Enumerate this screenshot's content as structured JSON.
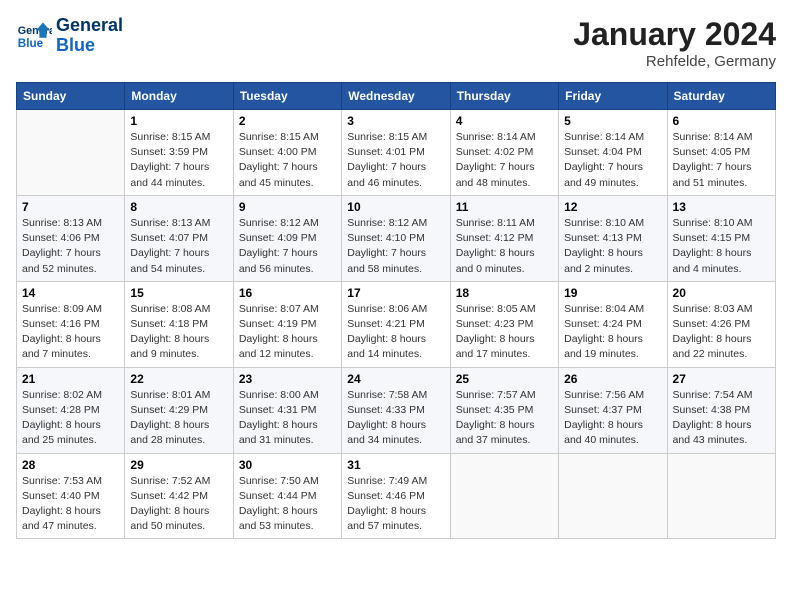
{
  "header": {
    "logo_line1": "General",
    "logo_line2": "Blue",
    "month": "January 2024",
    "location": "Rehfelde, Germany"
  },
  "days_of_week": [
    "Sunday",
    "Monday",
    "Tuesday",
    "Wednesday",
    "Thursday",
    "Friday",
    "Saturday"
  ],
  "weeks": [
    [
      {
        "day": "",
        "sunrise": "",
        "sunset": "",
        "daylight": "",
        "empty": true
      },
      {
        "day": "1",
        "sunrise": "Sunrise: 8:15 AM",
        "sunset": "Sunset: 3:59 PM",
        "daylight": "Daylight: 7 hours and 44 minutes."
      },
      {
        "day": "2",
        "sunrise": "Sunrise: 8:15 AM",
        "sunset": "Sunset: 4:00 PM",
        "daylight": "Daylight: 7 hours and 45 minutes."
      },
      {
        "day": "3",
        "sunrise": "Sunrise: 8:15 AM",
        "sunset": "Sunset: 4:01 PM",
        "daylight": "Daylight: 7 hours and 46 minutes."
      },
      {
        "day": "4",
        "sunrise": "Sunrise: 8:14 AM",
        "sunset": "Sunset: 4:02 PM",
        "daylight": "Daylight: 7 hours and 48 minutes."
      },
      {
        "day": "5",
        "sunrise": "Sunrise: 8:14 AM",
        "sunset": "Sunset: 4:04 PM",
        "daylight": "Daylight: 7 hours and 49 minutes."
      },
      {
        "day": "6",
        "sunrise": "Sunrise: 8:14 AM",
        "sunset": "Sunset: 4:05 PM",
        "daylight": "Daylight: 7 hours and 51 minutes."
      }
    ],
    [
      {
        "day": "7",
        "sunrise": "Sunrise: 8:13 AM",
        "sunset": "Sunset: 4:06 PM",
        "daylight": "Daylight: 7 hours and 52 minutes."
      },
      {
        "day": "8",
        "sunrise": "Sunrise: 8:13 AM",
        "sunset": "Sunset: 4:07 PM",
        "daylight": "Daylight: 7 hours and 54 minutes."
      },
      {
        "day": "9",
        "sunrise": "Sunrise: 8:12 AM",
        "sunset": "Sunset: 4:09 PM",
        "daylight": "Daylight: 7 hours and 56 minutes."
      },
      {
        "day": "10",
        "sunrise": "Sunrise: 8:12 AM",
        "sunset": "Sunset: 4:10 PM",
        "daylight": "Daylight: 7 hours and 58 minutes."
      },
      {
        "day": "11",
        "sunrise": "Sunrise: 8:11 AM",
        "sunset": "Sunset: 4:12 PM",
        "daylight": "Daylight: 8 hours and 0 minutes."
      },
      {
        "day": "12",
        "sunrise": "Sunrise: 8:10 AM",
        "sunset": "Sunset: 4:13 PM",
        "daylight": "Daylight: 8 hours and 2 minutes."
      },
      {
        "day": "13",
        "sunrise": "Sunrise: 8:10 AM",
        "sunset": "Sunset: 4:15 PM",
        "daylight": "Daylight: 8 hours and 4 minutes."
      }
    ],
    [
      {
        "day": "14",
        "sunrise": "Sunrise: 8:09 AM",
        "sunset": "Sunset: 4:16 PM",
        "daylight": "Daylight: 8 hours and 7 minutes."
      },
      {
        "day": "15",
        "sunrise": "Sunrise: 8:08 AM",
        "sunset": "Sunset: 4:18 PM",
        "daylight": "Daylight: 8 hours and 9 minutes."
      },
      {
        "day": "16",
        "sunrise": "Sunrise: 8:07 AM",
        "sunset": "Sunset: 4:19 PM",
        "daylight": "Daylight: 8 hours and 12 minutes."
      },
      {
        "day": "17",
        "sunrise": "Sunrise: 8:06 AM",
        "sunset": "Sunset: 4:21 PM",
        "daylight": "Daylight: 8 hours and 14 minutes."
      },
      {
        "day": "18",
        "sunrise": "Sunrise: 8:05 AM",
        "sunset": "Sunset: 4:23 PM",
        "daylight": "Daylight: 8 hours and 17 minutes."
      },
      {
        "day": "19",
        "sunrise": "Sunrise: 8:04 AM",
        "sunset": "Sunset: 4:24 PM",
        "daylight": "Daylight: 8 hours and 19 minutes."
      },
      {
        "day": "20",
        "sunrise": "Sunrise: 8:03 AM",
        "sunset": "Sunset: 4:26 PM",
        "daylight": "Daylight: 8 hours and 22 minutes."
      }
    ],
    [
      {
        "day": "21",
        "sunrise": "Sunrise: 8:02 AM",
        "sunset": "Sunset: 4:28 PM",
        "daylight": "Daylight: 8 hours and 25 minutes."
      },
      {
        "day": "22",
        "sunrise": "Sunrise: 8:01 AM",
        "sunset": "Sunset: 4:29 PM",
        "daylight": "Daylight: 8 hours and 28 minutes."
      },
      {
        "day": "23",
        "sunrise": "Sunrise: 8:00 AM",
        "sunset": "Sunset: 4:31 PM",
        "daylight": "Daylight: 8 hours and 31 minutes."
      },
      {
        "day": "24",
        "sunrise": "Sunrise: 7:58 AM",
        "sunset": "Sunset: 4:33 PM",
        "daylight": "Daylight: 8 hours and 34 minutes."
      },
      {
        "day": "25",
        "sunrise": "Sunrise: 7:57 AM",
        "sunset": "Sunset: 4:35 PM",
        "daylight": "Daylight: 8 hours and 37 minutes."
      },
      {
        "day": "26",
        "sunrise": "Sunrise: 7:56 AM",
        "sunset": "Sunset: 4:37 PM",
        "daylight": "Daylight: 8 hours and 40 minutes."
      },
      {
        "day": "27",
        "sunrise": "Sunrise: 7:54 AM",
        "sunset": "Sunset: 4:38 PM",
        "daylight": "Daylight: 8 hours and 43 minutes."
      }
    ],
    [
      {
        "day": "28",
        "sunrise": "Sunrise: 7:53 AM",
        "sunset": "Sunset: 4:40 PM",
        "daylight": "Daylight: 8 hours and 47 minutes."
      },
      {
        "day": "29",
        "sunrise": "Sunrise: 7:52 AM",
        "sunset": "Sunset: 4:42 PM",
        "daylight": "Daylight: 8 hours and 50 minutes."
      },
      {
        "day": "30",
        "sunrise": "Sunrise: 7:50 AM",
        "sunset": "Sunset: 4:44 PM",
        "daylight": "Daylight: 8 hours and 53 minutes."
      },
      {
        "day": "31",
        "sunrise": "Sunrise: 7:49 AM",
        "sunset": "Sunset: 4:46 PM",
        "daylight": "Daylight: 8 hours and 57 minutes."
      },
      {
        "day": "",
        "sunrise": "",
        "sunset": "",
        "daylight": "",
        "empty": true
      },
      {
        "day": "",
        "sunrise": "",
        "sunset": "",
        "daylight": "",
        "empty": true
      },
      {
        "day": "",
        "sunrise": "",
        "sunset": "",
        "daylight": "",
        "empty": true
      }
    ]
  ]
}
